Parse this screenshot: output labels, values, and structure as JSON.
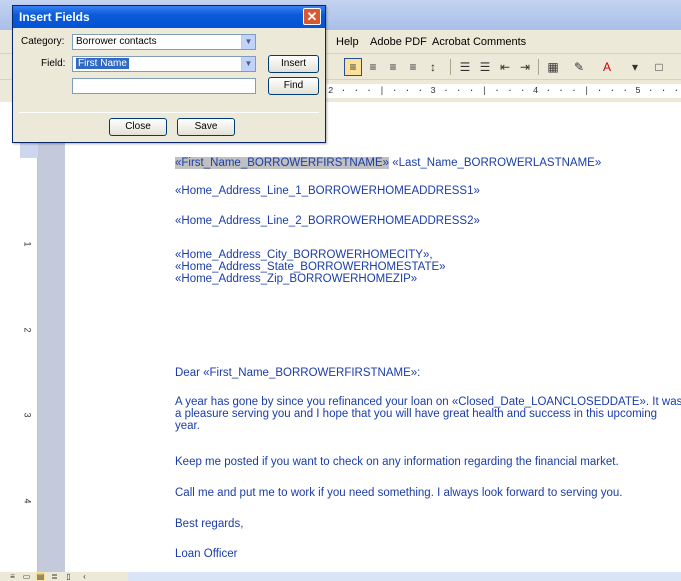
{
  "menu": {
    "help": "Help",
    "adobe_pdf": "Adobe PDF",
    "acrobat_comments": "Acrobat Comments"
  },
  "ruler": {
    "top_marks": "2 · · · | · · · 3 · · · | · · · 4 · · · | · · · 5 · · · | · ·",
    "left_marks": [
      "1",
      "2",
      "3",
      "4"
    ]
  },
  "dialog": {
    "title": "Insert Fields",
    "close_glyph": "✕",
    "category_label": "Category:",
    "category_value": "Borrower contacts",
    "field_label": "Field:",
    "field_value": "First Name",
    "insert_label": "Insert",
    "find_label": "Find",
    "find_value": "",
    "close_label": "Close",
    "save_label": "Save"
  },
  "document": {
    "first_name_field": "«First_Name_BORROWERFIRSTNAME»",
    "last_name_field": "«Last_Name_BORROWERLASTNAME»",
    "address1": "«Home_Address_Line_1_BORROWERHOMEADDRESS1»",
    "address2": "«Home_Address_Line_2_BORROWERHOMEADDRESS2»",
    "city": "«Home_Address_City_BORROWERHOMECITY»,",
    "state": "«Home_Address_State_BORROWERHOMESTATE»",
    "zip": "«Home_Address_Zip_BORROWERHOMEZIP»",
    "salutation": "Dear «First_Name_BORROWERFIRSTNAME»:",
    "para1": "A year has gone by since you refinanced your loan on «Closed_Date_LOANCLOSEDDATE». It was a pleasure serving you and I hope that you will have great health and success in this upcoming year.",
    "para2": "Keep me posted if you want to check on any information regarding the financial market.",
    "para3": "Call me and put me to work if you need something. I always look forward to serving you.",
    "closing": "Best regards,",
    "signature": "Loan Officer"
  },
  "colors": {
    "doc_text": "#1a3da8",
    "dialog_title_bar": "#0453d6",
    "field_highlight": "#c0c0c0"
  }
}
